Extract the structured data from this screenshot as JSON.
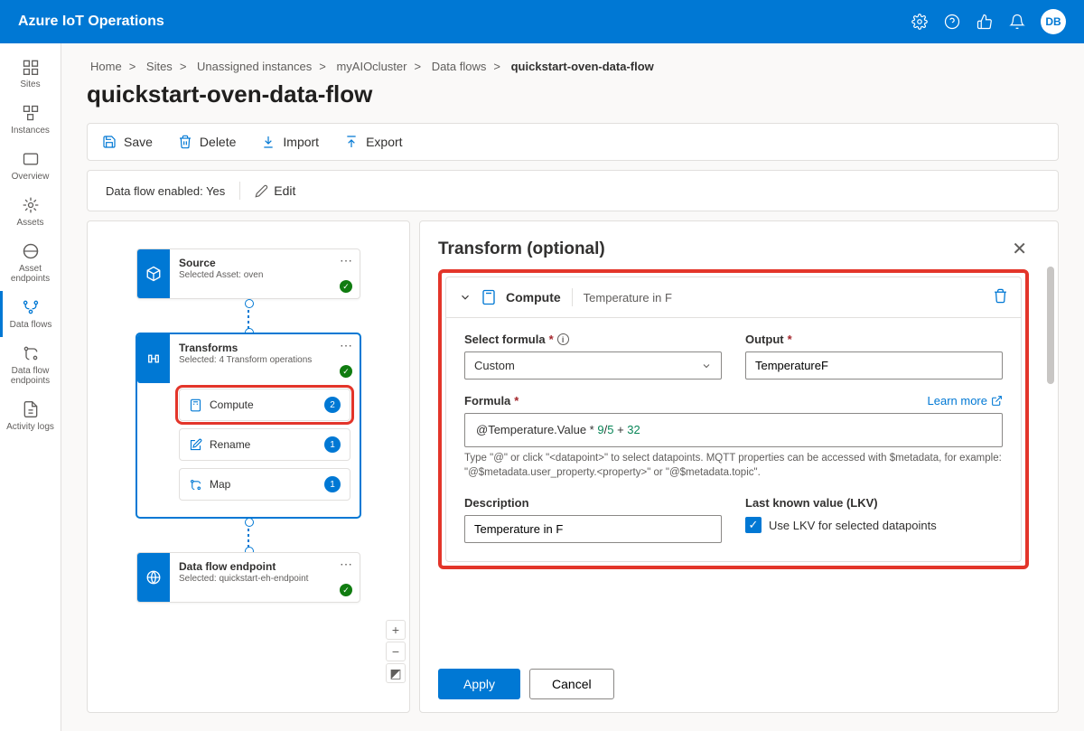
{
  "header": {
    "title": "Azure IoT Operations",
    "avatar": "DB"
  },
  "sidebar": {
    "items": [
      {
        "label": "Sites"
      },
      {
        "label": "Instances"
      },
      {
        "label": "Overview"
      },
      {
        "label": "Assets"
      },
      {
        "label": "Asset endpoints"
      },
      {
        "label": "Data flows"
      },
      {
        "label": "Data flow endpoints"
      },
      {
        "label": "Activity logs"
      }
    ]
  },
  "breadcrumb": [
    "Home",
    "Sites",
    "Unassigned instances",
    "myAIOcluster",
    "Data flows",
    "quickstart-oven-data-flow"
  ],
  "page_title": "quickstart-oven-data-flow",
  "toolbar": {
    "save": "Save",
    "delete": "Delete",
    "import": "Import",
    "export": "Export"
  },
  "status": {
    "label": "Data flow enabled:",
    "value": "Yes",
    "edit": "Edit"
  },
  "nodes": {
    "source": {
      "title": "Source",
      "sub": "Selected Asset: oven"
    },
    "transforms": {
      "title": "Transforms",
      "sub": "Selected: 4 Transform operations"
    },
    "ops": {
      "compute": {
        "label": "Compute",
        "count": "2"
      },
      "rename": {
        "label": "Rename",
        "count": "1"
      },
      "map": {
        "label": "Map",
        "count": "1"
      }
    },
    "endpoint": {
      "title": "Data flow endpoint",
      "sub": "Selected: quickstart-eh-endpoint"
    }
  },
  "panel": {
    "title": "Transform (optional)",
    "compute": {
      "head_label": "Compute",
      "head_sub": "Temperature in F",
      "formula_label": "Select formula",
      "formula_value": "Custom",
      "output_label": "Output",
      "output_value": "TemperatureF",
      "code_label": "Formula",
      "code_prefix": "@Temperature.Value * ",
      "code_num1": "9",
      "code_slash": "/",
      "code_num2": "5",
      "code_plus": " + ",
      "code_num3": "32",
      "hint": "Type \"@\" or click \"<datapoint>\" to select datapoints. MQTT properties can be accessed with $metadata, for example: \"@$metadata.user_property.<property>\" or \"@$metadata.topic\".",
      "learn_more": "Learn more",
      "desc_label": "Description",
      "desc_value": "Temperature in F",
      "lkv_label": "Last known value (LKV)",
      "lkv_check": "Use LKV for selected datapoints"
    },
    "apply": "Apply",
    "cancel": "Cancel"
  }
}
